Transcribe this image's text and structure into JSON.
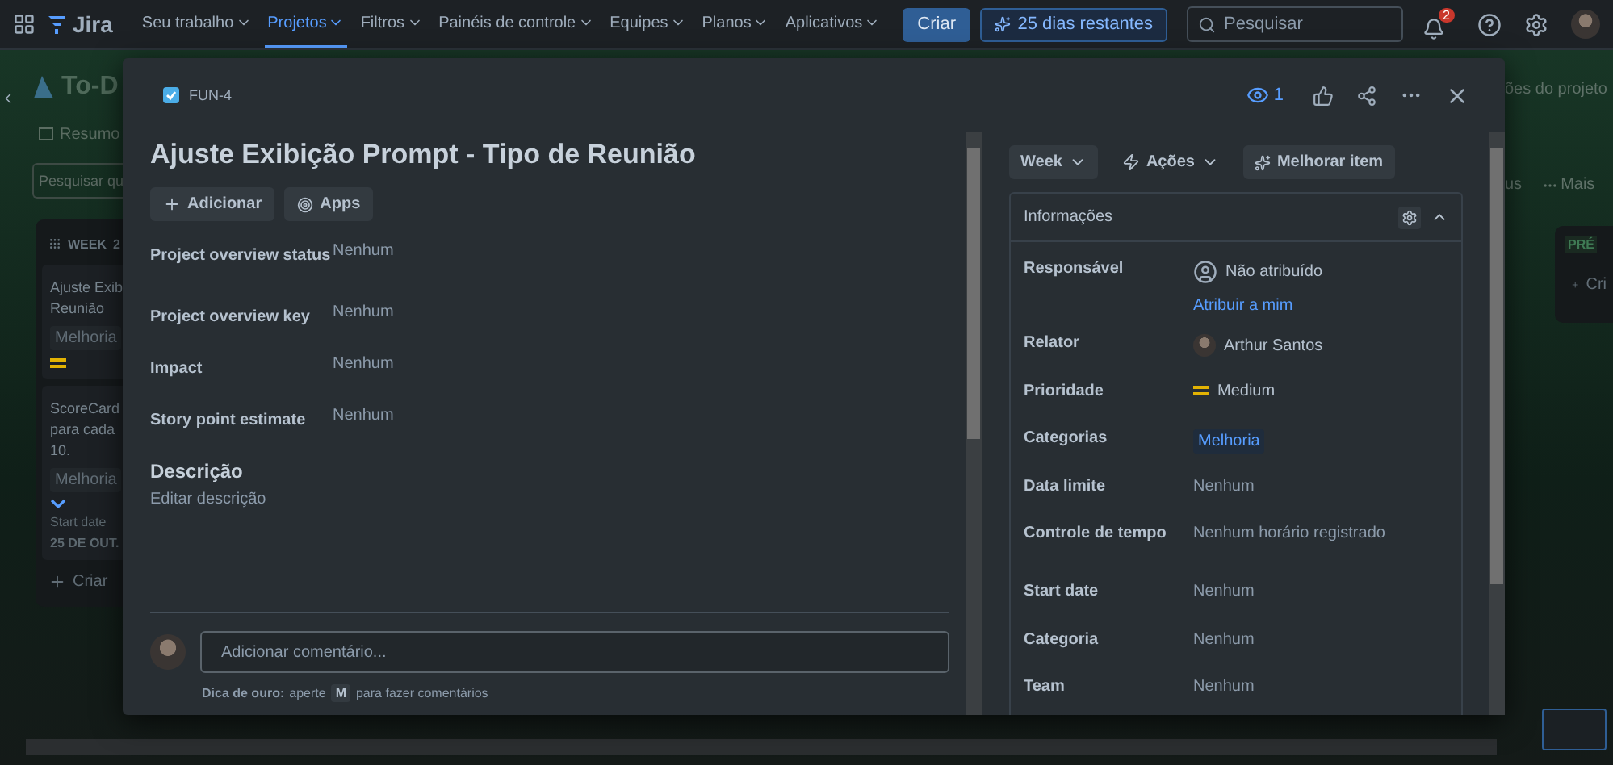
{
  "nav": {
    "product": "Jira",
    "items": [
      {
        "label": "Seu trabalho",
        "selected": false
      },
      {
        "label": "Projetos",
        "selected": true
      },
      {
        "label": "Filtros",
        "selected": false
      },
      {
        "label": "Painéis de controle",
        "selected": false
      },
      {
        "label": "Equipes",
        "selected": false
      },
      {
        "label": "Planos",
        "selected": false
      },
      {
        "label": "Aplicativos",
        "selected": false
      }
    ],
    "create": "Criar",
    "trial": "25 dias restantes",
    "search": {
      "placeholder": "Pesquisar"
    },
    "notification_count": "2"
  },
  "board": {
    "project": "To-D",
    "tab": "Resumo",
    "search": {
      "placeholder": "Pesquisar qu"
    },
    "column": {
      "title": "WEEK",
      "count": "2",
      "cards": [
        {
          "title": "Ajuste Exib\nReunião",
          "tag": "Melhoria",
          "kind": "medium"
        },
        {
          "title": "ScoreCard\npara cada\n10.",
          "tag": "Melhoria",
          "kind": "low",
          "date_label": "Start date",
          "date": "25 DE OUT."
        }
      ],
      "create": "Criar"
    },
    "right_link": "ões do projeto",
    "right_filter": "us",
    "more": "Mais",
    "next_column": {
      "title": "PRÉ",
      "create": "Cri"
    }
  },
  "issue": {
    "key": "FUN-4",
    "watchers": "1",
    "title": "Ajuste Exibição Prompt - Tipo de Reunião",
    "buttons": [
      "Adicionar",
      "Apps"
    ],
    "fields": [
      {
        "label": "Project overview status",
        "value": "Nenhum"
      },
      {
        "label": "Project overview key",
        "value": "Nenhum"
      },
      {
        "label": "Impact",
        "value": "Nenhum"
      },
      {
        "label": "Story point estimate",
        "value": "Nenhum"
      }
    ],
    "description": {
      "heading": "Descrição",
      "placeholder": "Editar descrição"
    },
    "comment": {
      "placeholder": "Adicionar comentário...",
      "tip_lead": "Dica de ouro:",
      "tip_before": "aperte",
      "tip_key": "M",
      "tip_after": "para fazer comentários"
    },
    "status": "Week",
    "actions": "Ações",
    "improve": "Melhorar item",
    "details": {
      "title": "Informações",
      "expanded": true,
      "rows": [
        {
          "kind": "unassigned",
          "label": "Responsável",
          "value": "Não atribuído",
          "action": "Atribuir a mim"
        },
        {
          "kind": "user",
          "label": "Relator",
          "value": "Arthur Santos"
        },
        {
          "kind": "priority",
          "label": "Prioridade",
          "value": "Medium"
        },
        {
          "kind": "tag",
          "label": "Categorias",
          "value": "Melhoria"
        },
        {
          "kind": "text",
          "label": "Data limite",
          "value": "Nenhum"
        },
        {
          "kind": "text",
          "label": "Controle de tempo",
          "value": "Nenhum horário registrado"
        },
        {
          "kind": "text",
          "label": "Start date",
          "value": "Nenhum"
        },
        {
          "kind": "text",
          "label": "Categoria",
          "value": "Nenhum"
        },
        {
          "kind": "text",
          "label": "Team",
          "value": "Nenhum"
        }
      ]
    }
  }
}
